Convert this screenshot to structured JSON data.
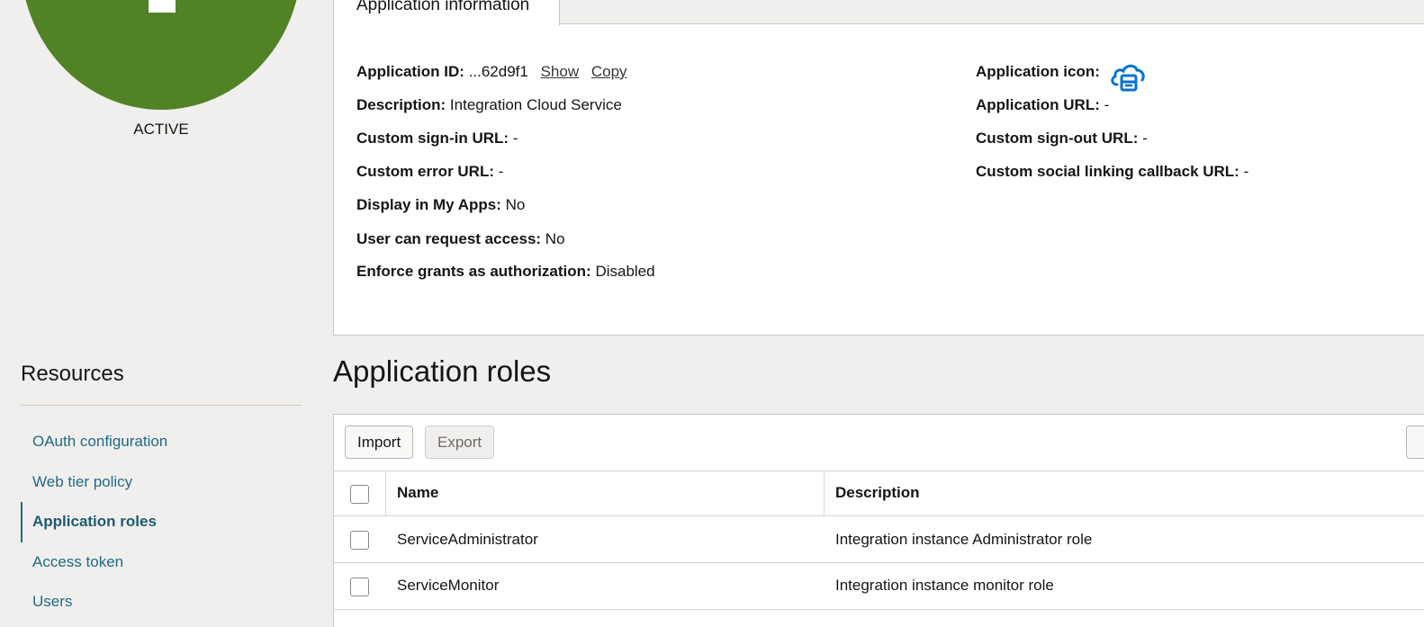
{
  "status": {
    "text": "ACTIVE",
    "color": "#518226"
  },
  "info_tab": {
    "label": "Application information"
  },
  "app_info": {
    "left": [
      {
        "label": "Application ID:",
        "value": "...62d9f1"
      },
      {
        "label": "Description:",
        "value": "Integration Cloud Service"
      },
      {
        "label": "Custom sign-in URL:",
        "value": "-"
      },
      {
        "label": "Custom error URL:",
        "value": "-"
      },
      {
        "label": "Display in My Apps:",
        "value": "No"
      },
      {
        "label": "User can request access:",
        "value": "No"
      },
      {
        "label": "Enforce grants as authorization:",
        "value": "Disabled"
      }
    ],
    "id_actions": {
      "show": "Show",
      "copy": "Copy"
    },
    "right": [
      {
        "label": "Application icon:",
        "value": "cloud-app-icon"
      },
      {
        "label": "Application URL:",
        "value": "-"
      },
      {
        "label": "Custom sign-out URL:",
        "value": "-"
      },
      {
        "label": "Custom social linking callback URL:",
        "value": "-"
      }
    ]
  },
  "resources": {
    "title": "Resources",
    "items": [
      {
        "label": "OAuth configuration",
        "active": false
      },
      {
        "label": "Web tier policy",
        "active": false
      },
      {
        "label": "Application roles",
        "active": true
      },
      {
        "label": "Access token",
        "active": false
      },
      {
        "label": "Users",
        "active": false
      }
    ]
  },
  "roles": {
    "title": "Application roles",
    "buttons": {
      "import": "Import",
      "export": "Export"
    },
    "columns": {
      "name": "Name",
      "description": "Description"
    },
    "rows": [
      {
        "name": "ServiceAdministrator",
        "description": "Integration instance Administrator role"
      },
      {
        "name": "ServiceMonitor",
        "description": "Integration instance monitor role"
      }
    ]
  },
  "colors": {
    "link": "#1f6a86",
    "icon": "#0572ce",
    "status": "#518226"
  }
}
